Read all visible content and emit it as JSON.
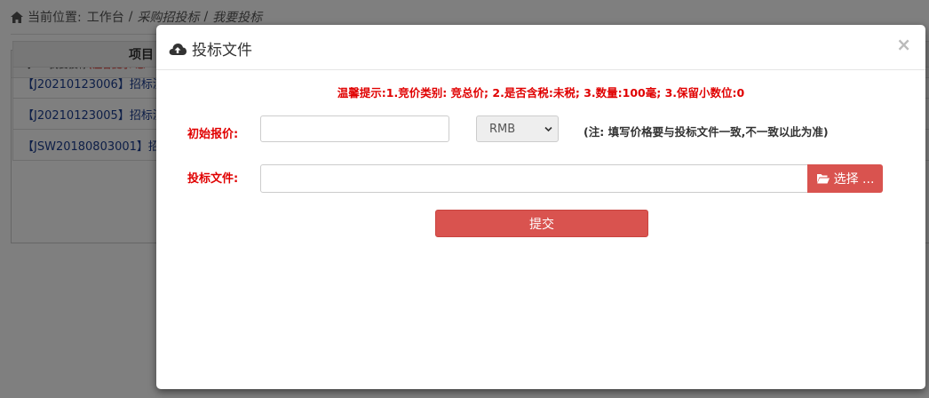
{
  "breadcrumb": {
    "label": "当前位置:",
    "items": [
      "工作台",
      "采购招投标",
      "我要投标"
    ],
    "separator": "/"
  },
  "panel": {
    "title": "我要投标",
    "tip_prefix": "(温馨提示:",
    "tip_text": "您"
  },
  "list": {
    "header": "项目",
    "rows": [
      "【J20210123006】招标测",
      "【J20210123005】招标测",
      "【JSW20180803001】招"
    ]
  },
  "modal": {
    "title": "投标文件",
    "close": "×",
    "notice": "温馨提示:1.竞价类别: 竞总价; 2.是否含税:未税; 3.数量:100毫; 3.保留小数位:0",
    "price_label": "初始报价:",
    "price_value": "",
    "currency_selected": "RMB",
    "price_note": "(注: 填写价格要与投标文件一致,不一致以此为准)",
    "file_label": "投标文件:",
    "file_value": "",
    "choose_label": "选择 ...",
    "submit_label": "提交"
  },
  "icons": {
    "breadcrumb": "home-icon",
    "panel": "hammer-icon",
    "title": "cloud-upload-icon",
    "choose": "folder-open-icon",
    "select": "chevron-down-icon"
  },
  "colors": {
    "danger": "#d9534f",
    "notice_red": "#e00000",
    "link_blue": "#1a3c8e"
  }
}
